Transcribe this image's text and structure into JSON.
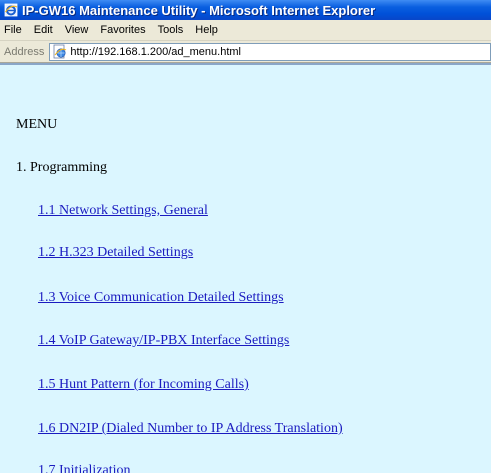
{
  "window": {
    "title": "IP-GW16 Maintenance Utility - Microsoft Internet Explorer"
  },
  "menubar": {
    "items": [
      "File",
      "Edit",
      "View",
      "Favorites",
      "Tools",
      "Help"
    ]
  },
  "addressbar": {
    "label": "Address",
    "url": "http://192.168.1.200/ad_menu.html"
  },
  "page": {
    "heading": "MENU",
    "section": "1. Programming",
    "links": [
      "1.1 Network Settings, General",
      "1.2 H.323 Detailed Settings",
      "1.3 Voice Communication Detailed Settings",
      "1.4 VoIP Gateway/IP-PBX Interface Settings",
      "1.5 Hunt Pattern (for Incoming Calls)",
      "1.6 DN2IP (Dialed Number to IP Address Translation)",
      "1.7 Initialization"
    ]
  },
  "colors": {
    "page_background": "#dbf6ff",
    "link": "#1a1ac0",
    "titlebar": "#0050d8"
  }
}
